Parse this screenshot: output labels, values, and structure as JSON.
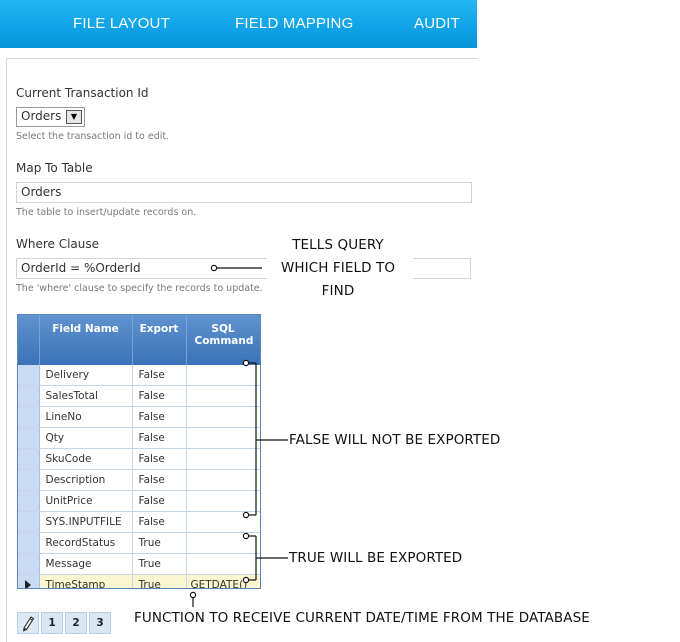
{
  "nav": {
    "tabs": [
      {
        "label": "FILE LAYOUT"
      },
      {
        "label": "FIELD MAPPING"
      },
      {
        "label": "AUDIT"
      }
    ]
  },
  "form": {
    "transaction": {
      "label": "Current Transaction Id",
      "value": "Orders",
      "hint": "Select the transaction id to edit."
    },
    "map_to_table": {
      "label": "Map To Table",
      "value": "Orders",
      "hint": "The table to insert/update records on."
    },
    "where_clause": {
      "label": "Where Clause",
      "value": "OrderId = %OrderId",
      "hint": "The 'where' clause to specify the records to update."
    }
  },
  "grid": {
    "headers": [
      "Field Name",
      "Export",
      "SQL Command"
    ],
    "rows": [
      {
        "field": "Delivery",
        "export": "False",
        "sql": ""
      },
      {
        "field": "SalesTotal",
        "export": "False",
        "sql": ""
      },
      {
        "field": "LineNo",
        "export": "False",
        "sql": ""
      },
      {
        "field": "Qty",
        "export": "False",
        "sql": ""
      },
      {
        "field": "SkuCode",
        "export": "False",
        "sql": ""
      },
      {
        "field": "Description",
        "export": "False",
        "sql": ""
      },
      {
        "field": "UnitPrice",
        "export": "False",
        "sql": ""
      },
      {
        "field": "SYS.INPUTFILE",
        "export": "False",
        "sql": ""
      },
      {
        "field": "RecordStatus",
        "export": "True",
        "sql": ""
      },
      {
        "field": "Message",
        "export": "True",
        "sql": ""
      },
      {
        "field": "TimeStamp",
        "export": "True",
        "sql": "GETDATE()"
      }
    ],
    "active_row": 10
  },
  "pager": {
    "icon": "pencil-icon",
    "pages": [
      "1",
      "2",
      "3"
    ]
  },
  "annotations": {
    "where_note_line1": "TELLS QUERY",
    "where_note_line2": "WHICH FIELD TO",
    "where_note_line3": "FIND",
    "false_note": "FALSE WILL NOT BE EXPORTED",
    "true_note": "TRUE WILL BE EXPORTED",
    "function_note": "FUNCTION TO RECEIVE CURRENT DATE/TIME FROM THE DATABASE"
  }
}
